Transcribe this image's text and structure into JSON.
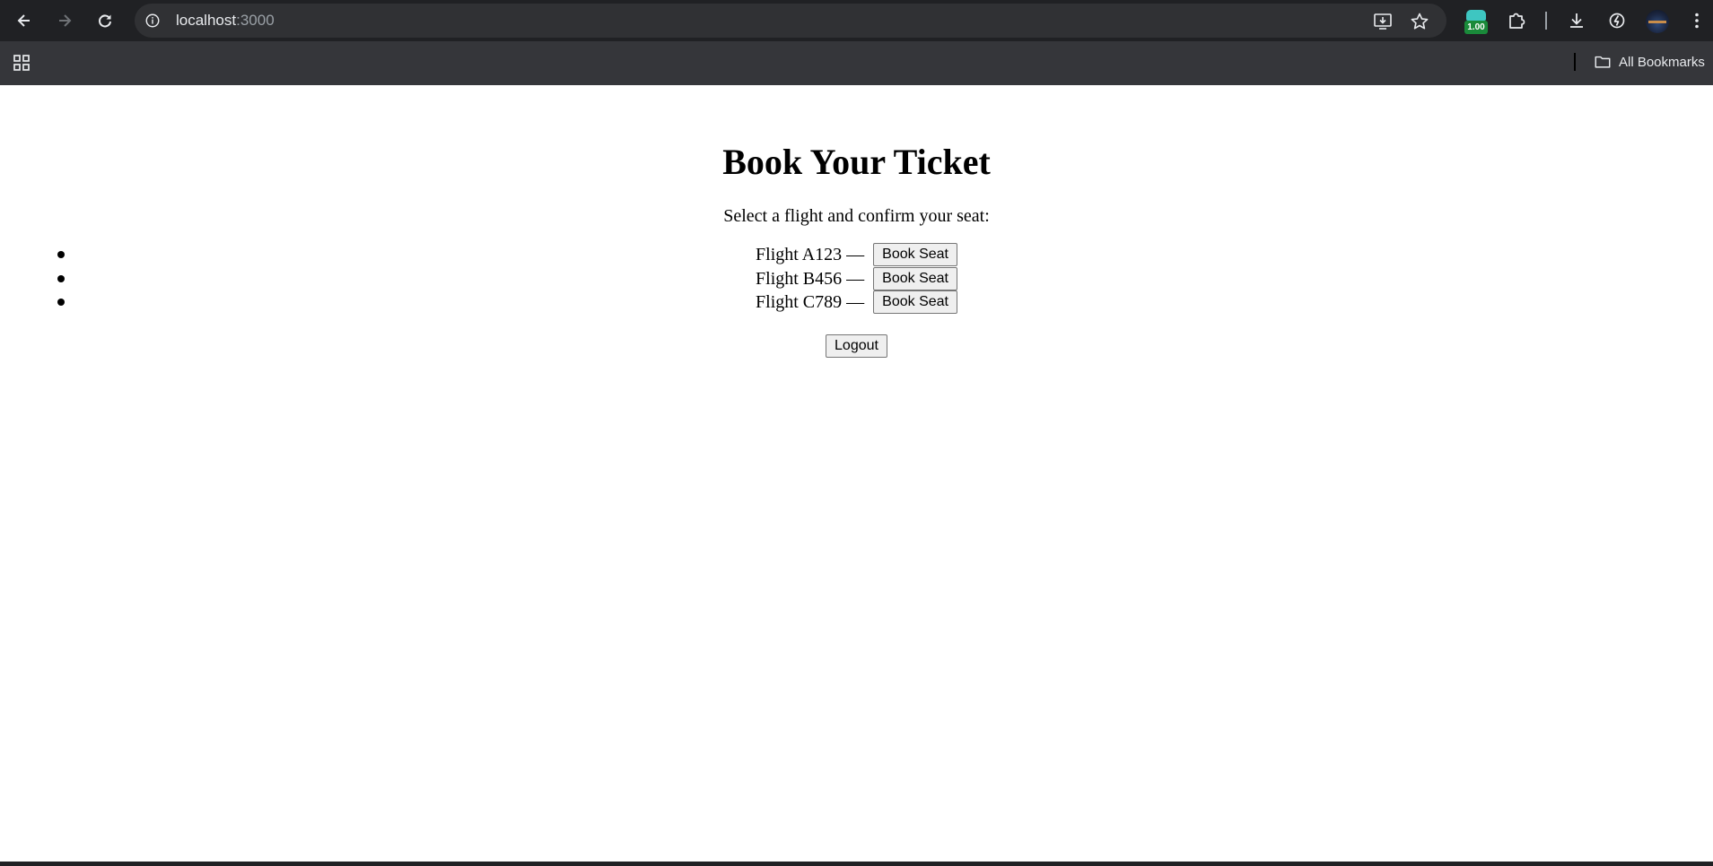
{
  "browser": {
    "url_host": "localhost",
    "url_port": ":3000",
    "extension_badge": "1.00",
    "bookmarks_label": "All Bookmarks"
  },
  "page": {
    "title": "Book Your Ticket",
    "subtitle": "Select a flight and confirm your seat:",
    "flights": [
      {
        "label": "Flight A123 — ",
        "button": "Book Seat"
      },
      {
        "label": "Flight B456 — ",
        "button": "Book Seat"
      },
      {
        "label": "Flight C789 — ",
        "button": "Book Seat"
      }
    ],
    "logout_label": "Logout"
  }
}
